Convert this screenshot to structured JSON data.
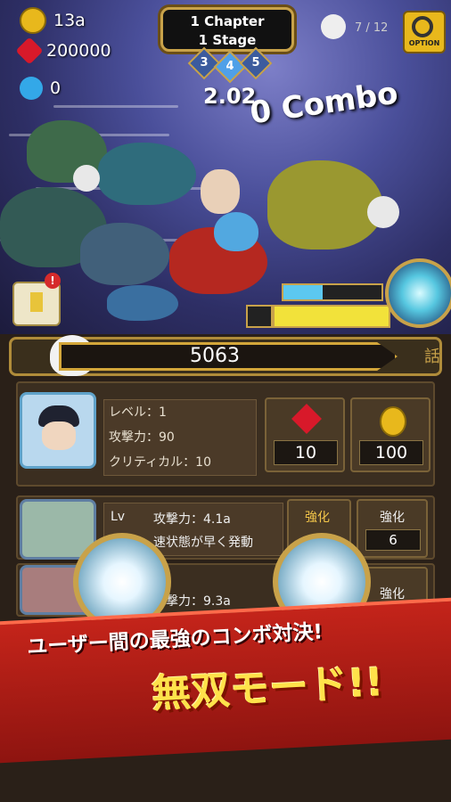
{
  "resources": {
    "gold": "13a",
    "gems": "200000",
    "souls": "0"
  },
  "stage": {
    "chapter": "1 Chapter",
    "stage": "1 Stage",
    "prev": "3",
    "current": "4",
    "next": "5"
  },
  "battle": {
    "timer": "2.02",
    "combo": "0 Combo",
    "kill_count": "7 / 12",
    "option_label": "OPTION"
  },
  "score": {
    "value": "5063",
    "side_label": "話"
  },
  "hero": {
    "level": "レベル：1",
    "attack": "攻撃力：90",
    "critical": "クリティカル：10",
    "gem_cost": "10",
    "gold_cost": "100"
  },
  "ally1": {
    "level_label": "Lv",
    "attack": "攻撃力：4.1a",
    "desc": "速状態が早く発動",
    "upgrade1": "強化",
    "upgrade2": "強化",
    "upgrade2_value": "6"
  },
  "ally2": {
    "attack": "撃力：9.3a",
    "upgrade": "強化"
  },
  "promo": {
    "subtitle": "ユーザー間の最強のコンボ対決!",
    "title": "無双モード!!"
  },
  "colors": {
    "gold_frame": "#c8a24a",
    "promo_red": "#c4241a",
    "promo_yellow": "#ffe24a"
  }
}
